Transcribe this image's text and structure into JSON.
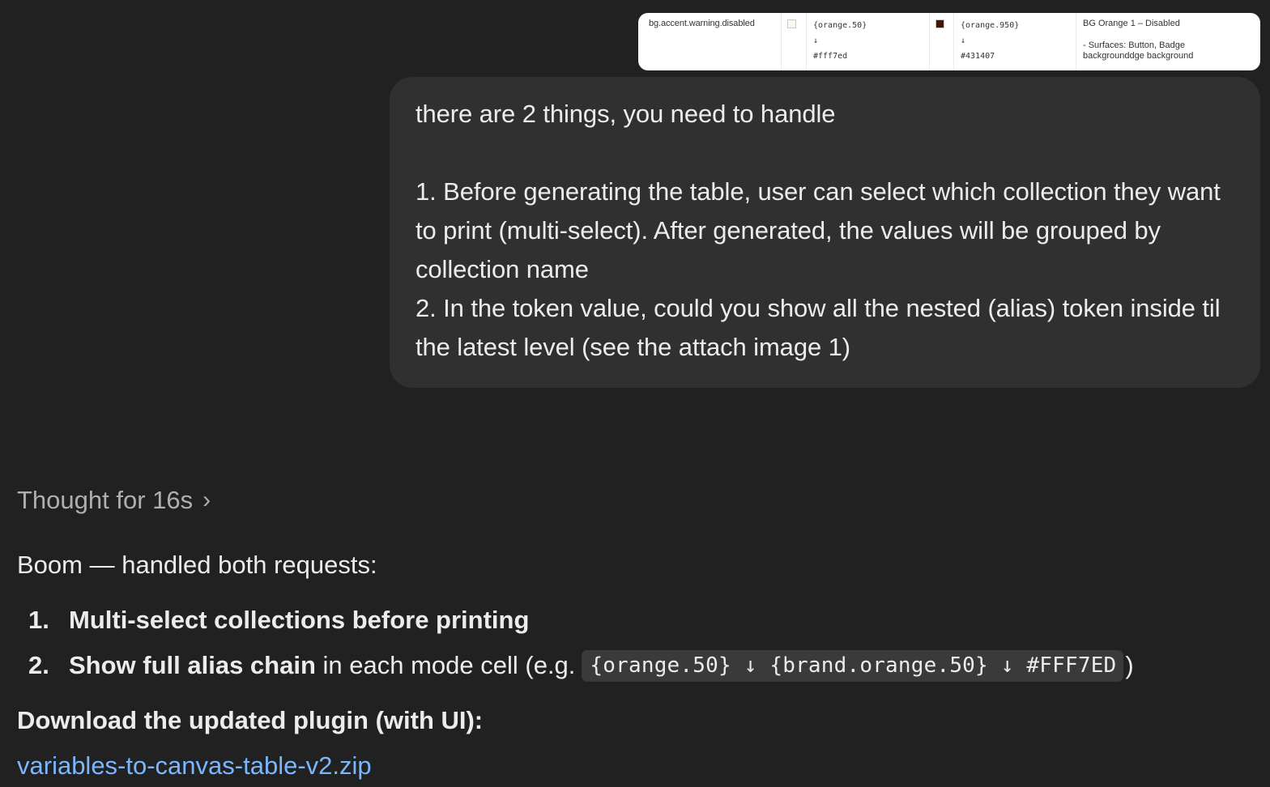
{
  "attachment": {
    "token_name": "bg.accent.warning.disabled",
    "mode1": {
      "swatch_color": "#fff7ed",
      "alias": "{orange.50}",
      "arrow": "↓",
      "resolved": "#fff7ed"
    },
    "mode2": {
      "swatch_color": "#431407",
      "alias": "{orange.950}",
      "arrow": "↓",
      "resolved": "#431407"
    },
    "description_title": "BG Orange 1 – Disabled",
    "description_text": "- Surfaces: Button, Badge\nbackgrounddge background"
  },
  "user_message": {
    "text": "there are 2 things, you need to handle\n\n1. Before generating the table, user can select which collection they want to print (multi-select). After generated, the values will be grouped by collection name\n2. In the token value, could you show all the nested (alias) token inside til the latest level (see the attach image 1)"
  },
  "assistant": {
    "thought_label": "Thought for 16s",
    "thought_icon": "chevron-right-icon",
    "intro": "Boom — handled both requests:",
    "steps": [
      {
        "number": "1.",
        "bold": "Multi-select collections before printing",
        "rest": "",
        "code": "",
        "tail": ""
      },
      {
        "number": "2.",
        "bold": "Show full alias chain",
        "rest": " in each mode cell (e.g.",
        "code": "{orange.50} ↓ {brand.orange.50} ↓ #FFF7ED",
        "tail": ")"
      }
    ],
    "download_heading": "Download the updated plugin (with UI):",
    "download_link": "variables-to-canvas-table-v2.zip"
  },
  "colors": {
    "background": "#212121",
    "bubble": "#303030",
    "link": "#7ab7ff",
    "muted": "#afafaf"
  }
}
